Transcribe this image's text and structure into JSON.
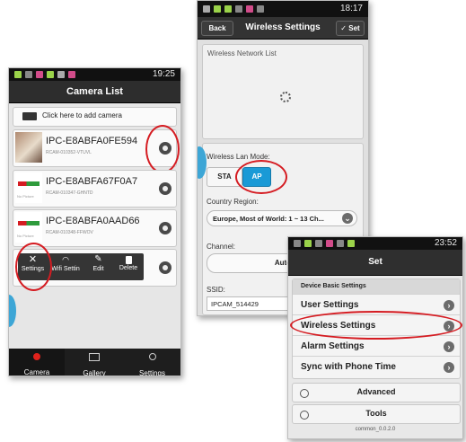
{
  "left": {
    "status_time": "19:25",
    "title": "Camera List",
    "add_camera": "Click here to add camera",
    "cameras": [
      {
        "name": "IPC-E8ABFA0FE594",
        "sub": "RCAM-010352-VTUVL"
      },
      {
        "name": "IPC-E8ABFA67F0A7",
        "sub": "RCAM-010347-GHNTD"
      },
      {
        "name": "IPC-E8ABFA0AAD66",
        "sub": "RCAM-010348-FFWOV"
      }
    ],
    "no_picture": "No Picture",
    "menu": [
      "Settings",
      "Wifi Settin",
      "Edit",
      "Delete"
    ],
    "tabs": [
      "Camera",
      "Gallery",
      "Settings"
    ],
    "colors": {
      "accent_red": "#d51c22",
      "tab_active": "#e0221c"
    }
  },
  "middle": {
    "status_time": "18:17",
    "back": "Back",
    "title": "Wireless Settings",
    "set": "Set",
    "network_list_label": "Wireless Network List",
    "mode_label": "Wireless Lan Mode:",
    "mode_sta": "STA",
    "mode_ap": "AP",
    "country_label": "Country Region:",
    "country_value": "Europe, Most of World: 1 ~ 13 Ch...",
    "channel_label": "Channel:",
    "channel_value": "Auto",
    "ssid_label": "SSID:",
    "ssid_value": "IPCAM_514429",
    "colors": {
      "ap_blue": "#1a9ad6"
    }
  },
  "right": {
    "status_time": "23:52",
    "title": "Set",
    "section": "Device Basic Settings",
    "items": [
      "User Settings",
      "Wireless Settings",
      "Alarm Settings",
      "Sync with Phone Time"
    ],
    "advanced": "Advanced",
    "tools": "Tools",
    "version": "common_0.0.2.0"
  }
}
